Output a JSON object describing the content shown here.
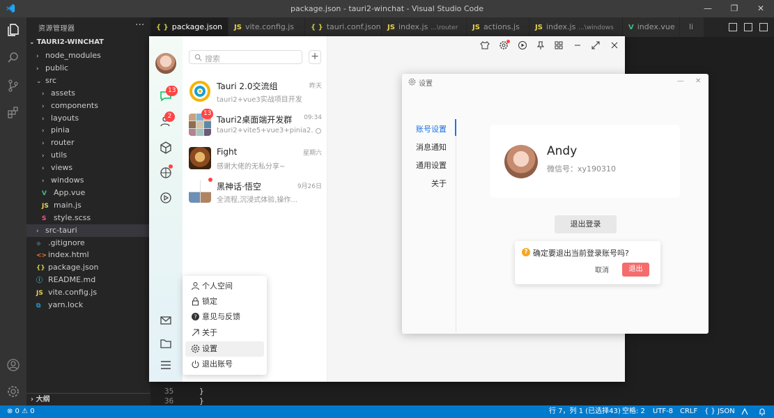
{
  "titlebar": {
    "title": "package.json - tauri2-winchat - Visual Studio Code",
    "minimize": "—",
    "restore": "❐",
    "close": "✕"
  },
  "sidebar": {
    "header": "资源管理器",
    "more": "···",
    "section": "TAURI2-WINCHAT",
    "items": [
      {
        "label": "node_modules",
        "type": "folder",
        "indent": 1
      },
      {
        "label": "public",
        "type": "folder",
        "indent": 1
      },
      {
        "label": "src",
        "type": "folder-open",
        "indent": 1
      },
      {
        "label": "assets",
        "type": "folder",
        "indent": 2
      },
      {
        "label": "components",
        "type": "folder",
        "indent": 2
      },
      {
        "label": "layouts",
        "type": "folder",
        "indent": 2
      },
      {
        "label": "pinia",
        "type": "folder",
        "indent": 2
      },
      {
        "label": "router",
        "type": "folder",
        "indent": 2
      },
      {
        "label": "utils",
        "type": "folder",
        "indent": 2
      },
      {
        "label": "views",
        "type": "folder",
        "indent": 2
      },
      {
        "label": "windows",
        "type": "folder",
        "indent": 2
      },
      {
        "label": "App.vue",
        "type": "vue",
        "indent": 2
      },
      {
        "label": "main.js",
        "type": "js",
        "indent": 2
      },
      {
        "label": "style.scss",
        "type": "scss",
        "indent": 2
      },
      {
        "label": "src-tauri",
        "type": "folder",
        "indent": 1
      },
      {
        "label": ".gitignore",
        "type": "git",
        "indent": 1
      },
      {
        "label": "index.html",
        "type": "html",
        "indent": 1
      },
      {
        "label": "package.json",
        "type": "json",
        "indent": 1
      },
      {
        "label": "README.md",
        "type": "md",
        "indent": 1
      },
      {
        "label": "vite.config.js",
        "type": "js",
        "indent": 1
      },
      {
        "label": "yarn.lock",
        "type": "yarn",
        "indent": 1
      }
    ],
    "outline": "大纲"
  },
  "tabs": [
    {
      "icon": "{ }",
      "label": "package.json",
      "sub": "",
      "close": "✕",
      "active": true
    },
    {
      "icon": "JS",
      "label": "vite.config.js",
      "sub": "",
      "close": "",
      "active": false
    },
    {
      "icon": "{ }",
      "label": "tauri.conf.json",
      "sub": "",
      "close": "",
      "active": false
    },
    {
      "icon": "JS",
      "label": "index.js",
      "sub": "...\\router",
      "close": "",
      "active": false
    },
    {
      "icon": "JS",
      "label": "actions.js",
      "sub": "",
      "close": "",
      "active": false
    },
    {
      "icon": "JS",
      "label": "index.js",
      "sub": "...\\windows",
      "close": "",
      "active": false
    },
    {
      "icon": "V",
      "label": "index.vue",
      "sub": "",
      "close": "",
      "active": false
    },
    {
      "icon": "",
      "label": "li",
      "sub": "",
      "close": "",
      "active": false
    }
  ],
  "editor": {
    "lines": [
      {
        "n": "35",
        "code": "  }"
      },
      {
        "n": "36",
        "code": "}"
      }
    ]
  },
  "statusbar": {
    "problems": "⊗ 0  ⚠ 0",
    "position": "行 7，列 1 (已选择43)",
    "spaces": "空格: 2",
    "encoding": "UTF-8",
    "eol": "CRLF",
    "language": "{ } JSON"
  },
  "chat": {
    "nav_badges": {
      "chat": "13",
      "contacts": "2"
    },
    "search_placeholder": "搜索",
    "add_label": "+",
    "conversations": [
      {
        "name": "Tauri 2.0交流组",
        "time": "昨天",
        "msg": "tauri2+vue3实战项目开发"
      },
      {
        "name": "Tauri2桌面端开发群",
        "time": "09:34",
        "msg": "tauri2+vite5+vue3+pinia2...",
        "badge": "13"
      },
      {
        "name": "Fight",
        "time": "星期六",
        "msg": "感谢大佬的无私分享~"
      },
      {
        "name": "黑神话·悟空",
        "time": "9月26日",
        "msg": "全流程,沉浸式体验,操作..."
      }
    ],
    "menu": [
      {
        "label": "个人空间",
        "icon": "user-icon"
      },
      {
        "label": "锁定",
        "icon": "lock-icon"
      },
      {
        "label": "意见与反馈",
        "icon": "help-icon"
      },
      {
        "label": "关于",
        "icon": "info-icon"
      },
      {
        "label": "设置",
        "icon": "gear-icon"
      },
      {
        "label": "退出账号",
        "icon": "power-icon"
      }
    ]
  },
  "settings": {
    "title": "设置",
    "nav": [
      "账号设置",
      "消息通知",
      "通用设置",
      "关于"
    ],
    "profile": {
      "name": "Andy",
      "wechat_id": "微信号：xy190310"
    },
    "logout_label": "退出登录",
    "confirm": {
      "question": "确定要退出当前登录账号吗?",
      "cancel": "取消",
      "ok": "退出"
    }
  },
  "colors": {
    "accent": "#1a73e8",
    "danger": "#f56c6c",
    "vscode_blue": "#007acc"
  }
}
